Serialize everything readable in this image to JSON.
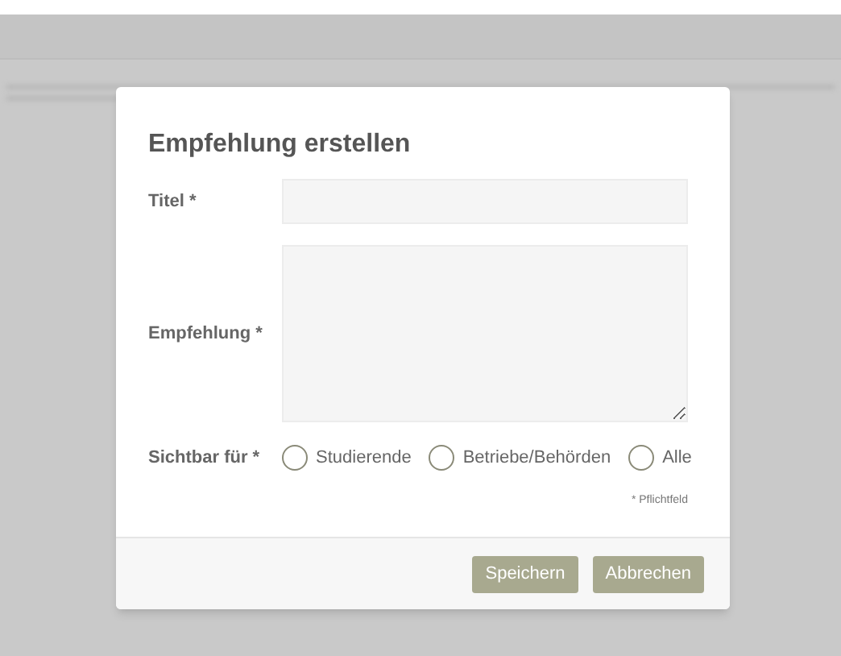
{
  "dialog": {
    "title": "Empfehlung erstellen",
    "fields": [
      {
        "label": "Titel *",
        "kind": "input"
      },
      {
        "label": "Empfehlung *",
        "kind": "textarea"
      }
    ],
    "visibility": {
      "label": "Sichtbar für *",
      "options": [
        {
          "label": "Studierende",
          "selected": false
        },
        {
          "label": "Betriebe/Behörden",
          "selected": false
        },
        {
          "label": "Alle",
          "selected": false
        }
      ]
    },
    "required_note": "* Pflichtfeld",
    "buttons": [
      "Speichern",
      "Abbrechen"
    ]
  }
}
